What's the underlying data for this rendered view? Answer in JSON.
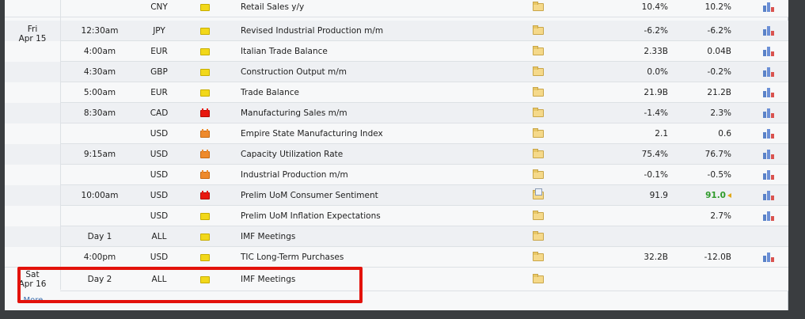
{
  "rows": [
    {
      "time": "",
      "currency": "CNY",
      "impact": "low",
      "event": "Retail Sales y/y",
      "detail": "folder",
      "actual": "10.4%",
      "previous": "10.2%",
      "actual_better": false
    },
    {
      "time": "12:30am",
      "currency": "JPY",
      "impact": "low",
      "event": "Revised Industrial Production m/m",
      "detail": "folder",
      "actual": "-6.2%",
      "previous": "-6.2%",
      "actual_better": false
    },
    {
      "time": "4:00am",
      "currency": "EUR",
      "impact": "low",
      "event": "Italian Trade Balance",
      "detail": "folder",
      "actual": "2.33B",
      "previous": "0.04B",
      "actual_better": false
    },
    {
      "time": "4:30am",
      "currency": "GBP",
      "impact": "low",
      "event": "Construction Output m/m",
      "detail": "folder",
      "actual": "0.0%",
      "previous": "-0.2%",
      "actual_better": false
    },
    {
      "time": "5:00am",
      "currency": "EUR",
      "impact": "low",
      "event": "Trade Balance",
      "detail": "folder",
      "actual": "21.9B",
      "previous": "21.2B",
      "actual_better": false
    },
    {
      "time": "8:30am",
      "currency": "CAD",
      "impact": "high",
      "event": "Manufacturing Sales m/m",
      "detail": "folder",
      "actual": "-1.4%",
      "previous": "2.3%",
      "actual_better": false
    },
    {
      "time": "",
      "currency": "USD",
      "impact": "med",
      "event": "Empire State Manufacturing Index",
      "detail": "folder",
      "actual": "2.1",
      "previous": "0.6",
      "actual_better": false
    },
    {
      "time": "9:15am",
      "currency": "USD",
      "impact": "med",
      "event": "Capacity Utilization Rate",
      "detail": "folder",
      "actual": "75.4%",
      "previous": "76.7%",
      "actual_better": false
    },
    {
      "time": "",
      "currency": "USD",
      "impact": "med",
      "event": "Industrial Production m/m",
      "detail": "folder",
      "actual": "-0.1%",
      "previous": "-0.5%",
      "actual_better": false
    },
    {
      "time": "10:00am",
      "currency": "USD",
      "impact": "high",
      "event": "Prelim UoM Consumer Sentiment",
      "detail": "doc",
      "actual": "91.9",
      "previous": "91.0",
      "actual_better": true
    },
    {
      "time": "",
      "currency": "USD",
      "impact": "low",
      "event": "Prelim UoM Inflation Expectations",
      "detail": "folder",
      "actual": "",
      "previous": "2.7%",
      "actual_better": false
    },
    {
      "time": "Day 1",
      "currency": "ALL",
      "impact": "low",
      "event": "IMF Meetings",
      "detail": "folder",
      "actual": "",
      "previous": "",
      "actual_better": false,
      "no_chart": true
    },
    {
      "time": "4:00pm",
      "currency": "USD",
      "impact": "low",
      "event": "TIC Long-Term Purchases",
      "detail": "folder",
      "actual": "32.2B",
      "previous": "-12.0B",
      "actual_better": false
    },
    {
      "time": "Day 2",
      "currency": "ALL",
      "impact": "low",
      "event": "IMF Meetings",
      "detail": "folder",
      "actual": "",
      "previous": "",
      "actual_better": false,
      "no_chart": true
    }
  ],
  "days": [
    {
      "line1": "Fri",
      "line2": "Apr 15"
    },
    {
      "line1": "Sat",
      "line2": "Apr 16"
    }
  ],
  "more_label": "More",
  "colors": {
    "highlight": "#e3120b",
    "better": "#2e9a2a",
    "link": "#3a6fb0"
  },
  "icons": {
    "impact": "impact-icon",
    "detail": "folder-icon",
    "chart": "bar-chart-icon",
    "more": "down-arrow-icon"
  }
}
